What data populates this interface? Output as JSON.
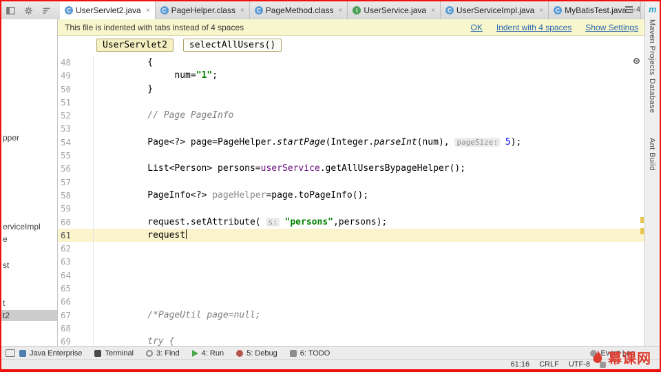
{
  "tab_bar": {
    "tabs": [
      {
        "label": "UserServlet2.java",
        "icon": "class",
        "active": true
      },
      {
        "label": "PageHelper.class",
        "icon": "class",
        "active": false
      },
      {
        "label": "PageMethod.class",
        "icon": "class",
        "active": false
      },
      {
        "label": "UserService.java",
        "icon": "interface",
        "active": false
      },
      {
        "label": "UserServiceImpl.java",
        "icon": "class",
        "active": false
      },
      {
        "label": "MyBatisTest.java",
        "icon": "class",
        "active": false
      }
    ],
    "hidden_tabs_count": "4"
  },
  "banner": {
    "message": "This file is indented with tabs instead of 4 spaces",
    "actions": [
      "OK",
      "Indent with 4 spaces",
      "Show Settings"
    ]
  },
  "breadcrumbs": [
    "UserServlet2",
    "selectAllUsers()"
  ],
  "project_panel": {
    "items": [
      "pper",
      "erviceImpl",
      "e",
      "st",
      "t",
      "t2"
    ],
    "selected_index": 5
  },
  "tool_strips": {
    "maven_icon": "m",
    "right": [
      "Maven Projects",
      "Database",
      "Ant Build"
    ]
  },
  "editor": {
    "current_line": 61,
    "colors": {
      "string": "#008000",
      "comment": "#808080",
      "number": "#0000ff",
      "field": "#660e7a",
      "unused": "#8a8a8a",
      "hint_text": "#8c8c8c",
      "current_line_bg": "#faf3cb"
    },
    "lines": [
      {
        "n": 48,
        "s": [
          {
            "c": "plain",
            "t": "          {"
          }
        ]
      },
      {
        "n": 49,
        "s": [
          {
            "c": "plain",
            "t": "               num="
          },
          {
            "c": "string",
            "t": "\"1\""
          },
          {
            "c": "plain",
            "t": ";"
          }
        ]
      },
      {
        "n": 50,
        "s": [
          {
            "c": "plain",
            "t": "          }"
          }
        ]
      },
      {
        "n": 51,
        "s": []
      },
      {
        "n": 52,
        "s": [
          {
            "c": "comment",
            "t": "          // Page PageInfo"
          }
        ]
      },
      {
        "n": 53,
        "s": []
      },
      {
        "n": 54,
        "s": [
          {
            "c": "plain",
            "t": "          Page<?> page=PageHelper."
          },
          {
            "c": "method-static",
            "t": "startPage"
          },
          {
            "c": "plain",
            "t": "(Integer."
          },
          {
            "c": "method-static",
            "t": "parseInt"
          },
          {
            "c": "plain",
            "t": "(num), "
          },
          {
            "c": "hint",
            "t": "pageSize:"
          },
          {
            "c": "plain",
            "t": " "
          },
          {
            "c": "number",
            "t": "5"
          },
          {
            "c": "plain",
            "t": ");"
          }
        ]
      },
      {
        "n": 55,
        "s": []
      },
      {
        "n": 56,
        "s": [
          {
            "c": "plain",
            "t": "          List<Person> persons="
          },
          {
            "c": "field",
            "t": "userService"
          },
          {
            "c": "plain",
            "t": ".getAllUsersBypageHelper();"
          }
        ]
      },
      {
        "n": 57,
        "s": []
      },
      {
        "n": 58,
        "s": [
          {
            "c": "plain",
            "t": "          PageInfo<?> "
          },
          {
            "c": "unused",
            "t": "pageHelper"
          },
          {
            "c": "plain",
            "t": "=page.toPageInfo();"
          }
        ]
      },
      {
        "n": 59,
        "s": []
      },
      {
        "n": 60,
        "s": [
          {
            "c": "plain",
            "t": "          request.setAttribute( "
          },
          {
            "c": "hint",
            "t": "s:"
          },
          {
            "c": "plain",
            "t": " "
          },
          {
            "c": "string",
            "t": "\"persons\""
          },
          {
            "c": "plain",
            "t": ",persons);"
          }
        ]
      },
      {
        "n": 61,
        "caret": true,
        "s": [
          {
            "c": "plain",
            "t": "          request"
          }
        ]
      },
      {
        "n": 62,
        "s": []
      },
      {
        "n": 63,
        "s": []
      },
      {
        "n": 64,
        "s": []
      },
      {
        "n": 65,
        "s": []
      },
      {
        "n": 66,
        "s": []
      },
      {
        "n": 67,
        "s": [
          {
            "c": "comment",
            "t": "          /*PageUtil page=null;"
          }
        ]
      },
      {
        "n": 68,
        "s": []
      },
      {
        "n": 69,
        "s": [
          {
            "c": "comment",
            "t": "          try {"
          }
        ]
      }
    ]
  },
  "bottom_bar": {
    "left": [
      {
        "label": "Java Enterprise",
        "icon": "java-enterprise-icon"
      },
      {
        "label": "Terminal",
        "icon": "terminal-icon"
      },
      {
        "label": "3: Find",
        "icon": "find-icon"
      },
      {
        "label": "4: Run",
        "icon": "run-icon"
      },
      {
        "label": "5: Debug",
        "icon": "debug-icon"
      },
      {
        "label": "6: TODO",
        "icon": "todo-icon"
      }
    ],
    "right": [
      {
        "label": "Event Log",
        "icon": "event-log-icon"
      }
    ]
  },
  "status_bar": {
    "caret_position": "61:16",
    "line_ending": "CRLF",
    "encoding": "UTF-8"
  },
  "watermark": {
    "text": "幕课网",
    "color": "#dd3b2f"
  }
}
